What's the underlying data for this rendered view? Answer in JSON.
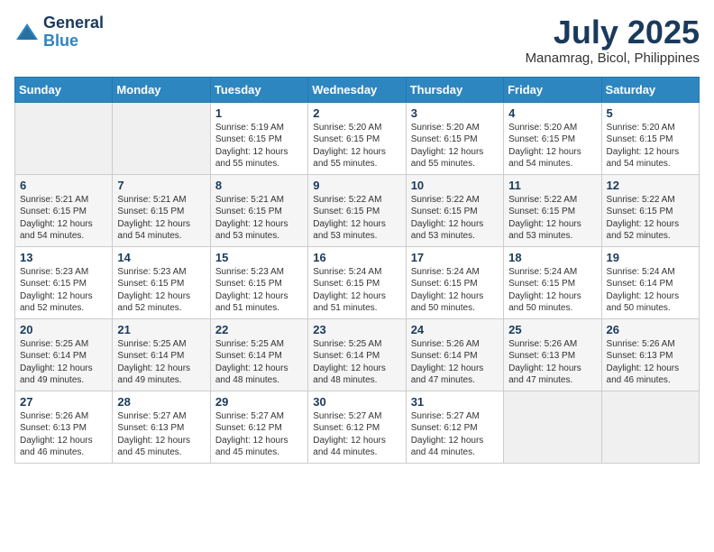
{
  "header": {
    "logo_line1": "General",
    "logo_line2": "Blue",
    "month_year": "July 2025",
    "location": "Manamrag, Bicol, Philippines"
  },
  "weekdays": [
    "Sunday",
    "Monday",
    "Tuesday",
    "Wednesday",
    "Thursday",
    "Friday",
    "Saturday"
  ],
  "weeks": [
    [
      {
        "day": "",
        "content": ""
      },
      {
        "day": "",
        "content": ""
      },
      {
        "day": "1",
        "content": "Sunrise: 5:19 AM\nSunset: 6:15 PM\nDaylight: 12 hours\nand 55 minutes."
      },
      {
        "day": "2",
        "content": "Sunrise: 5:20 AM\nSunset: 6:15 PM\nDaylight: 12 hours\nand 55 minutes."
      },
      {
        "day": "3",
        "content": "Sunrise: 5:20 AM\nSunset: 6:15 PM\nDaylight: 12 hours\nand 55 minutes."
      },
      {
        "day": "4",
        "content": "Sunrise: 5:20 AM\nSunset: 6:15 PM\nDaylight: 12 hours\nand 54 minutes."
      },
      {
        "day": "5",
        "content": "Sunrise: 5:20 AM\nSunset: 6:15 PM\nDaylight: 12 hours\nand 54 minutes."
      }
    ],
    [
      {
        "day": "6",
        "content": "Sunrise: 5:21 AM\nSunset: 6:15 PM\nDaylight: 12 hours\nand 54 minutes."
      },
      {
        "day": "7",
        "content": "Sunrise: 5:21 AM\nSunset: 6:15 PM\nDaylight: 12 hours\nand 54 minutes."
      },
      {
        "day": "8",
        "content": "Sunrise: 5:21 AM\nSunset: 6:15 PM\nDaylight: 12 hours\nand 53 minutes."
      },
      {
        "day": "9",
        "content": "Sunrise: 5:22 AM\nSunset: 6:15 PM\nDaylight: 12 hours\nand 53 minutes."
      },
      {
        "day": "10",
        "content": "Sunrise: 5:22 AM\nSunset: 6:15 PM\nDaylight: 12 hours\nand 53 minutes."
      },
      {
        "day": "11",
        "content": "Sunrise: 5:22 AM\nSunset: 6:15 PM\nDaylight: 12 hours\nand 53 minutes."
      },
      {
        "day": "12",
        "content": "Sunrise: 5:22 AM\nSunset: 6:15 PM\nDaylight: 12 hours\nand 52 minutes."
      }
    ],
    [
      {
        "day": "13",
        "content": "Sunrise: 5:23 AM\nSunset: 6:15 PM\nDaylight: 12 hours\nand 52 minutes."
      },
      {
        "day": "14",
        "content": "Sunrise: 5:23 AM\nSunset: 6:15 PM\nDaylight: 12 hours\nand 52 minutes."
      },
      {
        "day": "15",
        "content": "Sunrise: 5:23 AM\nSunset: 6:15 PM\nDaylight: 12 hours\nand 51 minutes."
      },
      {
        "day": "16",
        "content": "Sunrise: 5:24 AM\nSunset: 6:15 PM\nDaylight: 12 hours\nand 51 minutes."
      },
      {
        "day": "17",
        "content": "Sunrise: 5:24 AM\nSunset: 6:15 PM\nDaylight: 12 hours\nand 50 minutes."
      },
      {
        "day": "18",
        "content": "Sunrise: 5:24 AM\nSunset: 6:15 PM\nDaylight: 12 hours\nand 50 minutes."
      },
      {
        "day": "19",
        "content": "Sunrise: 5:24 AM\nSunset: 6:14 PM\nDaylight: 12 hours\nand 50 minutes."
      }
    ],
    [
      {
        "day": "20",
        "content": "Sunrise: 5:25 AM\nSunset: 6:14 PM\nDaylight: 12 hours\nand 49 minutes."
      },
      {
        "day": "21",
        "content": "Sunrise: 5:25 AM\nSunset: 6:14 PM\nDaylight: 12 hours\nand 49 minutes."
      },
      {
        "day": "22",
        "content": "Sunrise: 5:25 AM\nSunset: 6:14 PM\nDaylight: 12 hours\nand 48 minutes."
      },
      {
        "day": "23",
        "content": "Sunrise: 5:25 AM\nSunset: 6:14 PM\nDaylight: 12 hours\nand 48 minutes."
      },
      {
        "day": "24",
        "content": "Sunrise: 5:26 AM\nSunset: 6:14 PM\nDaylight: 12 hours\nand 47 minutes."
      },
      {
        "day": "25",
        "content": "Sunrise: 5:26 AM\nSunset: 6:13 PM\nDaylight: 12 hours\nand 47 minutes."
      },
      {
        "day": "26",
        "content": "Sunrise: 5:26 AM\nSunset: 6:13 PM\nDaylight: 12 hours\nand 46 minutes."
      }
    ],
    [
      {
        "day": "27",
        "content": "Sunrise: 5:26 AM\nSunset: 6:13 PM\nDaylight: 12 hours\nand 46 minutes."
      },
      {
        "day": "28",
        "content": "Sunrise: 5:27 AM\nSunset: 6:13 PM\nDaylight: 12 hours\nand 45 minutes."
      },
      {
        "day": "29",
        "content": "Sunrise: 5:27 AM\nSunset: 6:12 PM\nDaylight: 12 hours\nand 45 minutes."
      },
      {
        "day": "30",
        "content": "Sunrise: 5:27 AM\nSunset: 6:12 PM\nDaylight: 12 hours\nand 44 minutes."
      },
      {
        "day": "31",
        "content": "Sunrise: 5:27 AM\nSunset: 6:12 PM\nDaylight: 12 hours\nand 44 minutes."
      },
      {
        "day": "",
        "content": ""
      },
      {
        "day": "",
        "content": ""
      }
    ]
  ]
}
